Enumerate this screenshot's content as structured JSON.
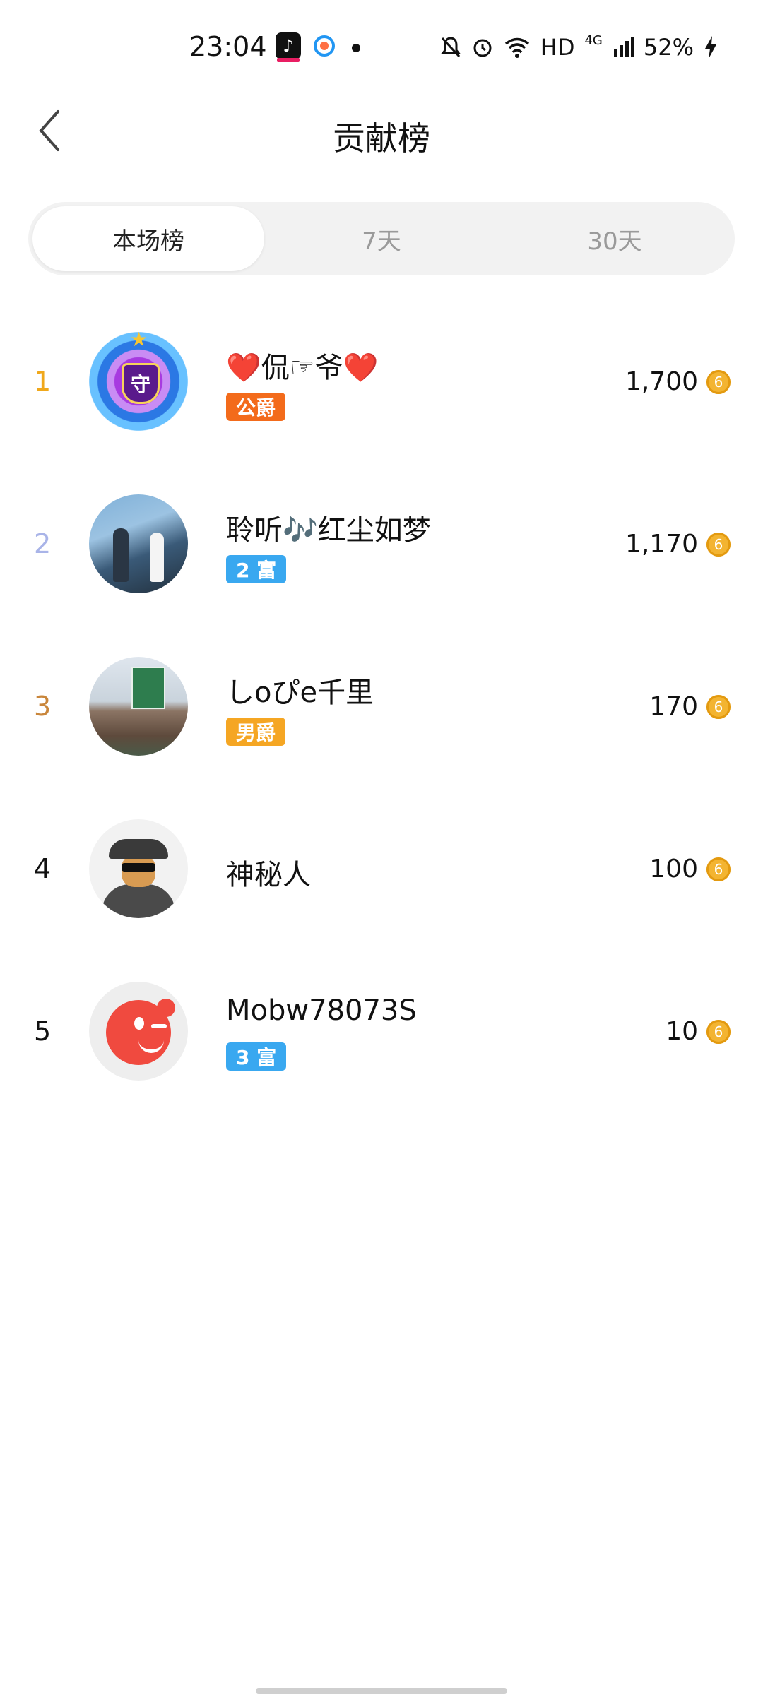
{
  "status_bar": {
    "time": "23:04",
    "network": "HD",
    "signal": "4G",
    "battery": "52%"
  },
  "header": {
    "title": "贡献榜"
  },
  "tabs": [
    {
      "label": "本场榜",
      "active": true
    },
    {
      "label": "7天",
      "active": false
    },
    {
      "label": "30天",
      "active": false
    }
  ],
  "leaderboard": [
    {
      "rank": "1",
      "rank_color": "#f0a81b",
      "name": "❤️侃☞爷❤️",
      "badge": "公爵",
      "badge_color": "#f36b1b",
      "score": "1,700",
      "avatar_icon": "guardian-badge"
    },
    {
      "rank": "2",
      "rank_color": "#a9b4e8",
      "name": "聆听🎶红尘如梦",
      "badge": "2 富",
      "badge_color": "#39a8f0",
      "score": "1,170",
      "avatar_icon": "anime-characters"
    },
    {
      "rank": "3",
      "rank_color": "#c9863b",
      "name": "しoぴe千里",
      "badge": "男爵",
      "badge_color": "#f5a623",
      "score": "170",
      "avatar_icon": "road-sign-photo"
    },
    {
      "rank": "4",
      "rank_color": "#111111",
      "name": "神秘人",
      "badge": "",
      "badge_color": "",
      "score": "100",
      "avatar_icon": "mystery-man"
    },
    {
      "rank": "5",
      "rank_color": "#111111",
      "name": "Mobw78073S",
      "badge": "3 富",
      "badge_color": "#39a8f0",
      "score": "10",
      "avatar_icon": "winking-blob"
    }
  ],
  "coin_symbol": "6"
}
